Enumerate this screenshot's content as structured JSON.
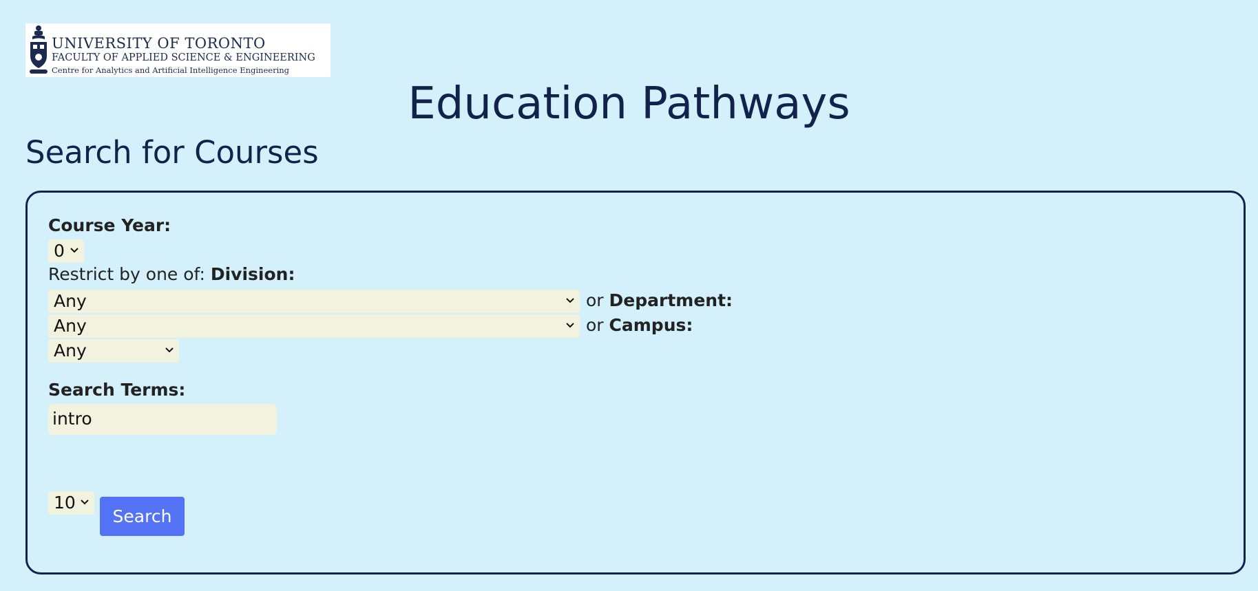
{
  "logo": {
    "line1": "UNIVERSITY OF TORONTO",
    "line2": "FACULTY OF APPLIED SCIENCE & ENGINEERING",
    "line3": "Centre for Analytics and Artificial Intelligence Engineering"
  },
  "app_title": "Education Pathways",
  "section_title": "Search for Courses",
  "form": {
    "course_year_label": "Course Year:",
    "course_year_value": "0",
    "restrict_prefix": "Restrict by one of: ",
    "division_label": "Division:",
    "division_value": "Any",
    "or_text": "or",
    "department_label": "Department:",
    "department_value": "Any",
    "campus_label": "Campus:",
    "campus_value": "Any",
    "search_terms_label": "Search Terms:",
    "search_terms_value": "intro",
    "results_count_value": "10",
    "search_button_label": "Search"
  },
  "colors": {
    "background": "#d4f1fb",
    "text": "#13224b",
    "field": "#f1f3de",
    "button": "#5472f5"
  },
  "icons": {
    "crest": "university-crest-icon",
    "dropdown": "chevron-down-icon"
  }
}
